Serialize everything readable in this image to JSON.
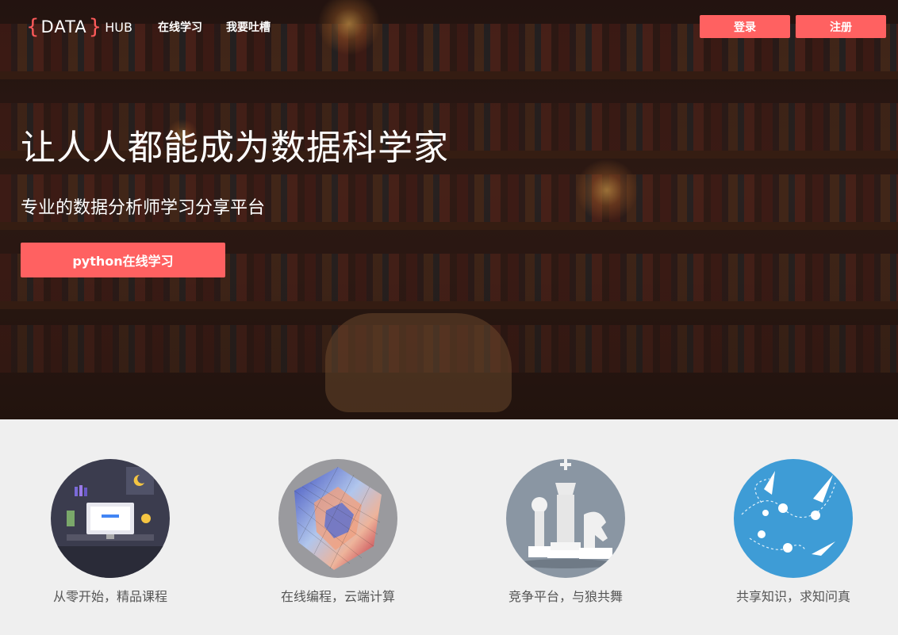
{
  "header": {
    "logo": {
      "open_brace": "{",
      "data_text": "DATA",
      "close_brace": "}",
      "hub_text": "HUB"
    },
    "nav": [
      "在线学习",
      "我要吐槽"
    ],
    "login_label": "登录",
    "register_label": "注册"
  },
  "hero": {
    "title": "让人人都能成为数据科学家",
    "subtitle": "专业的数据分析师学习分享平台",
    "cta_label": "python在线学习"
  },
  "features": [
    {
      "icon": "workspace-illustration-icon",
      "label": "从零开始，精品课程"
    },
    {
      "icon": "3d-surface-plot-icon",
      "label": "在线编程，云端计算"
    },
    {
      "icon": "chess-pieces-icon",
      "label": "竞争平台，与狼共舞"
    },
    {
      "icon": "paper-planes-icon",
      "label": "共享知识，求知问真"
    }
  ],
  "colors": {
    "accent": "#ff6161",
    "feature_bg": "#efefef",
    "label": "#555555"
  }
}
